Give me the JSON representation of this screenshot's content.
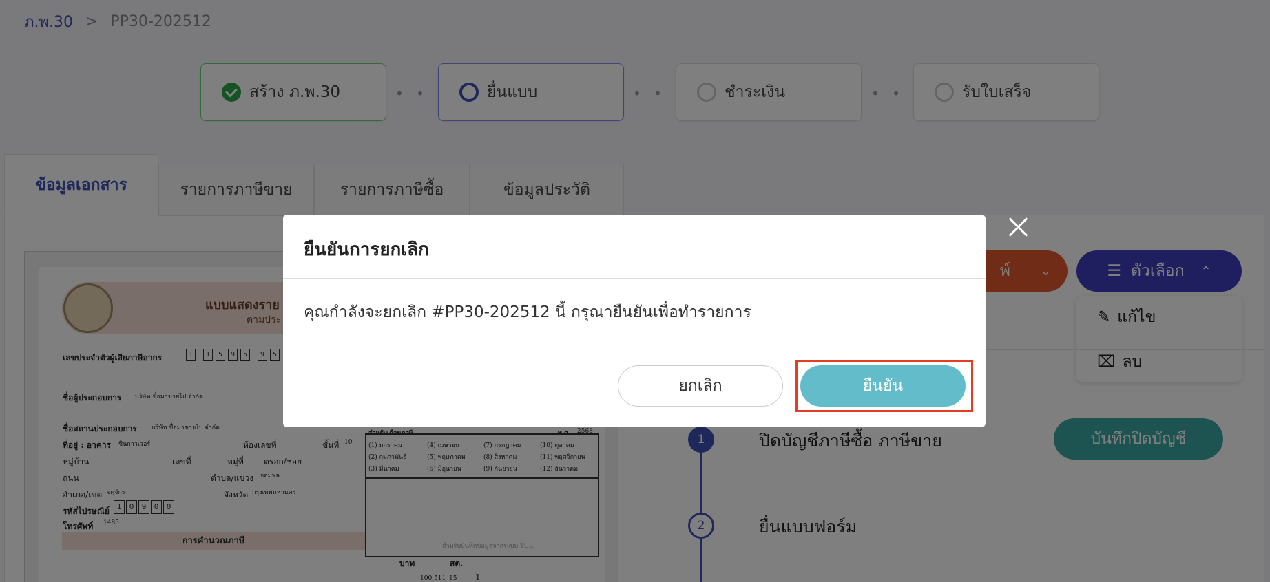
{
  "breadcrumb": {
    "root": "ภ.พ.30",
    "separator": ">",
    "current": "PP30-202512"
  },
  "stepper": {
    "steps": [
      {
        "label": "สร้าง ภ.พ.30",
        "state": "done"
      },
      {
        "label": "ยื่นแบบ",
        "state": "active"
      },
      {
        "label": "ชำระเงิน",
        "state": "pending"
      },
      {
        "label": "รับใบเสร็จ",
        "state": "pending"
      }
    ],
    "dots": "• • •"
  },
  "tabs": [
    {
      "label": "ข้อมูลเอกสาร",
      "active": true
    },
    {
      "label": "รายการภาษีขาย",
      "active": false
    },
    {
      "label": "รายการภาษีซื้อ",
      "active": false
    },
    {
      "label": "ข้อมูลประวัติ",
      "active": false
    }
  ],
  "document": {
    "title": "แบบแสดงราย",
    "subtitle": "ตามประ",
    "taxpayer_id_label": "เลขประจำตัวผู้เสียภาษีอากร",
    "taxpayer_id_digits": [
      "1",
      "1",
      "5",
      "9",
      "5",
      "9",
      "5"
    ],
    "operator_name_label": "ชื่อผู้ประกอบการ",
    "operator_name": "บริษัท ชื่อมาขายไป จำกัด",
    "place_name_label": "ชื่อสถานประกอบการ",
    "place_name": "บริษัท ชื่อมาขายไป จำกัด",
    "address_label": "ที่อยู่ : อาคาร",
    "building": "ชินกาวเวอร์",
    "room_label": "ห้องเลขที่",
    "floor_label": "ชั้นที่",
    "floor": "10",
    "village_label": "หมู่บ้าน",
    "house_no_label": "เลขที่",
    "moo_label": "หมู่ที่",
    "soi_label": "ตรอก/ซอย",
    "road_label": "ถนน",
    "subdistrict_label": "ตำบล/แขวง",
    "subdistrict": "จอมพล",
    "district_label": "อำเภอ/เขต",
    "district": "จตุจักร",
    "province_label": "จังหวัด",
    "province": "กรุงเทพมหานคร",
    "postcode_label": "รหัสไปรษณีย์",
    "postcode_digits": [
      "1",
      "0",
      "9",
      "0",
      "0"
    ],
    "phone_label": "โทรศัพท์",
    "phone": "1485",
    "calc_label": "การคำนวณภาษี",
    "month_header": "สำหรับเดือนภาษี",
    "year_label": "พ.ศ.",
    "year": "2568",
    "months": [
      "(1) มกราคม",
      "(4) เมษายน",
      "(7) กรกฎาคม",
      "(10) ตุลาคม",
      "(2) กุมภาพันธ์",
      "(5) พฤษภาคม",
      "(8) สิงหาคม",
      "(11) พฤศจิกายน",
      "(3) มีนาคม",
      "(6) มิถุนายน",
      "(9) กันยายน",
      "(12) ธันวาคม"
    ],
    "tcl_note": "สำหรับบันทึกข้อมูลจากระบบ TCL",
    "baht_label": "บาท",
    "satang_label": "สต.",
    "line1_amount": "100,511",
    "line1_satang": "15",
    "line1_count": "1"
  },
  "right_panel": {
    "print_button_partial": "พ์",
    "options_button": "ตัวเลือก",
    "menu": [
      {
        "label": "แก้ไข",
        "icon": "edit-icon"
      },
      {
        "label": "ลบ",
        "icon": "delete-file-icon"
      }
    ],
    "timeline": [
      {
        "number": "1",
        "label": "ปิดบัญชีภาษีซื้อ ภาษีขาย"
      },
      {
        "number": "2",
        "label": "ยื่นแบบฟอร์ม"
      }
    ],
    "close_books_button": "บันทึกปิดบัญชี"
  },
  "modal": {
    "title": "ยืนยันการยกเลิก",
    "message": "คุณกำลังจะยกเลิก #PP30-202512 นี้ กรุณายืนยันเพื่อทำรายการ",
    "cancel_label": "ยกเลิก",
    "confirm_label": "ยืนยัน"
  },
  "colors": {
    "accent": "#3f51b5",
    "confirm": "#63bcc9",
    "highlight": "#e53d1f",
    "print_button": "#e2582f",
    "options_button": "#3f3fc0",
    "close_books_button": "#3aa9a5"
  }
}
